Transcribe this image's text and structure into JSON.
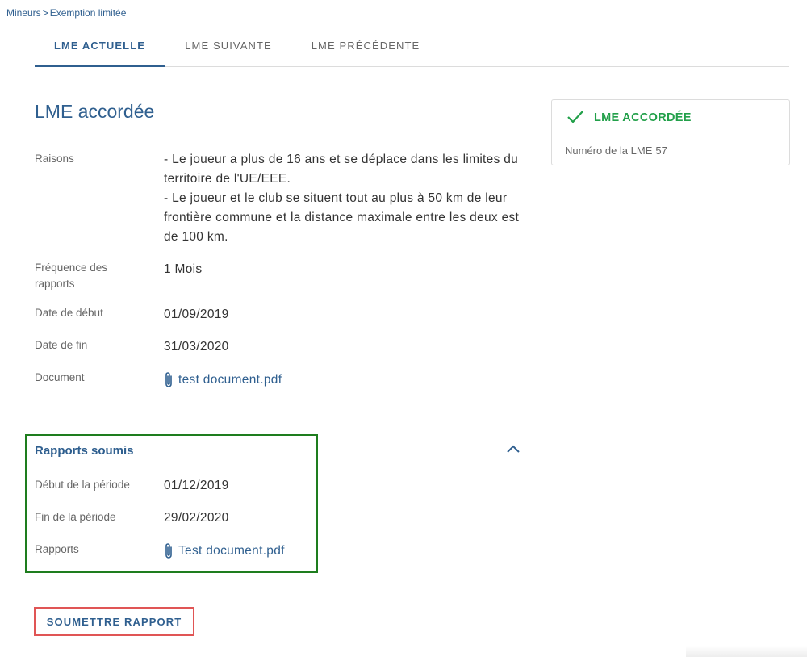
{
  "breadcrumb": {
    "parent": "Mineurs",
    "separator": ">",
    "current": "Exemption limitée"
  },
  "tabs": [
    {
      "label": "LME ACTUELLE",
      "active": true
    },
    {
      "label": "LME SUIVANTE",
      "active": false
    },
    {
      "label": "LME PRÉCÉDENTE",
      "active": false
    }
  ],
  "main": {
    "title": "LME accordée",
    "fields": {
      "reasons_label": "Raisons",
      "reasons_lines": [
        "- Le joueur a plus de 16 ans et se déplace dans les limites du territoire de l'UE/EEE.",
        "- Le joueur et le club se situent tout au plus à 50 km de leur frontière commune et la distance maximale entre les deux est de 100 km."
      ],
      "frequency_label_1": "Fréquence des",
      "frequency_label_2": "rapports",
      "frequency_value": "1 Mois",
      "start_label": "Date de début",
      "start_value": "01/09/2019",
      "end_label": "Date de fin",
      "end_value": "31/03/2020",
      "document_label": "Document",
      "document_value": "test document.pdf"
    }
  },
  "reports": {
    "title": "Rapports soumis",
    "expanded": true,
    "period_start_label": "Début de la période",
    "period_start_value": "01/12/2019",
    "period_end_label": "Fin de la période",
    "period_end_value": "29/02/2020",
    "reports_label": "Rapports",
    "reports_file": "Test document.pdf"
  },
  "submit_button": "SOUMETTRE RAPPORT",
  "status_card": {
    "status": "LME ACCORDÉE",
    "number_label": "Numéro de la LME",
    "number": "57"
  },
  "colors": {
    "accent": "#2f5f8f",
    "success": "#22a04a",
    "highlight_green": "#1e7d1e",
    "highlight_red": "#e05555"
  },
  "icons": [
    "chevron-right-icon",
    "paperclip-icon",
    "chevron-up-icon",
    "check-icon"
  ]
}
